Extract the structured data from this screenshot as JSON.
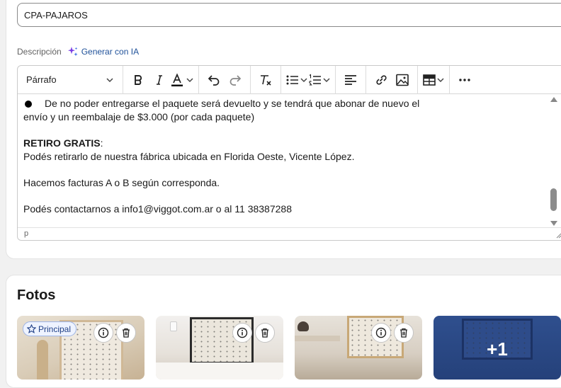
{
  "product": {
    "name_value": "CPA-PAJAROS"
  },
  "description": {
    "label": "Descripción",
    "ai_button_label": "Generar con IA"
  },
  "toolbar": {
    "block_format": "Párrafo"
  },
  "content": {
    "bullet_line1": "De no poder entregarse el paquete será devuelto y se tendrá que abonar de nuevo el",
    "bullet_line2": "envío y un reembalaje de $3.000 (por cada paquete)",
    "retiro_heading": "RETIRO GRATIS",
    "retiro_colon": ":",
    "retiro_text": "Podés retirarlo de nuestra fábrica ubicada en Florida Oeste, Vicente López.",
    "facturas_text": "Hacemos facturas A o B según corresponda.",
    "contacto_text": "Podés contactarnos a info1@viggot.com.ar o al 11 38387288"
  },
  "status_bar": {
    "path": "p"
  },
  "photos": {
    "title": "Fotos",
    "principal_badge": "Principal",
    "more_count": "+1",
    "icon_names": [
      "info-icon",
      "trash-icon",
      "star-icon"
    ]
  },
  "colors": {
    "accent": "#1f5199",
    "badge_bg": "#eef3ff",
    "blue_photo": "#2f4f8e"
  }
}
